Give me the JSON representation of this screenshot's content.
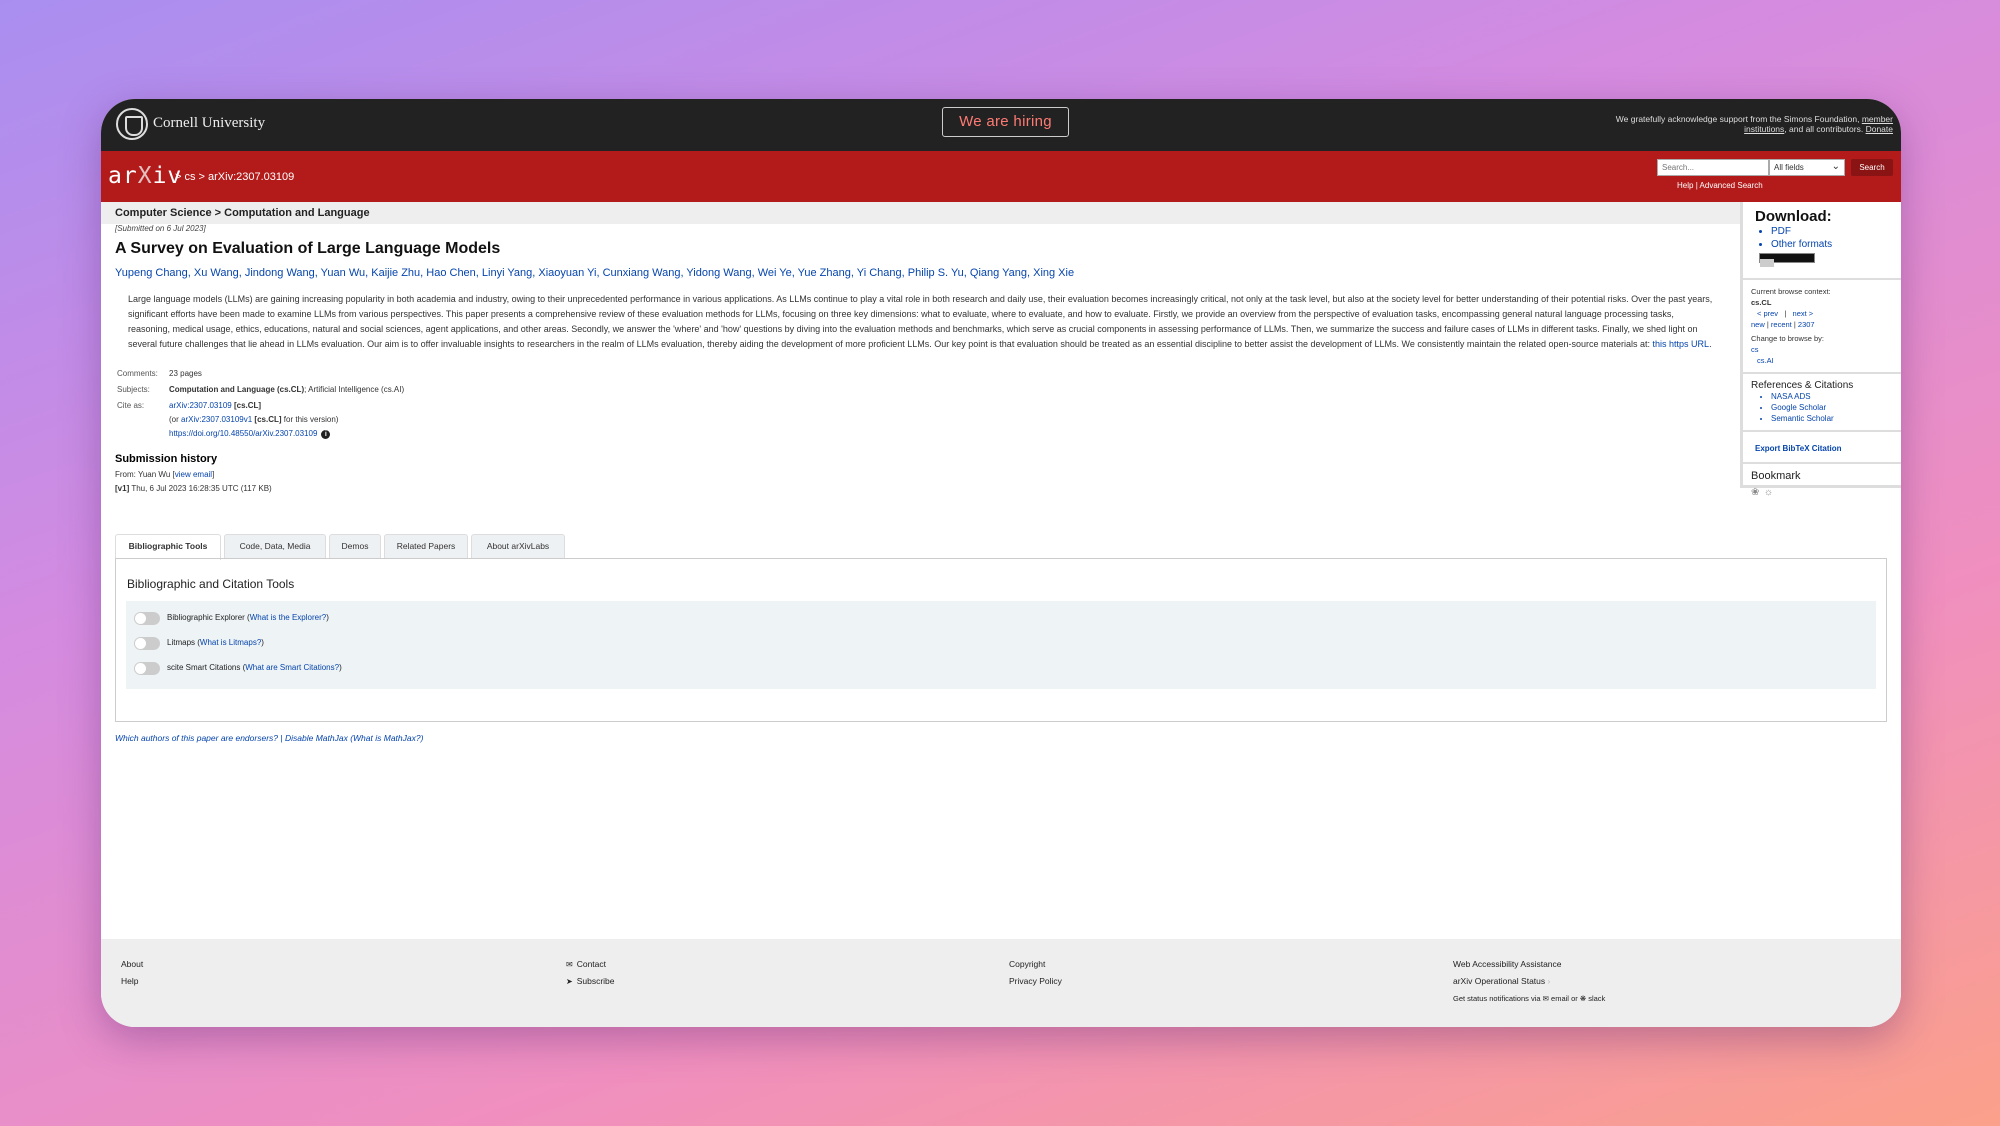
{
  "cornell": {
    "name": "Cornell University",
    "hiring": "We are hiring",
    "ack_text": "We gratefully acknowledge support from the Simons Foundation,",
    "ack_link1": "member institutions",
    "ack_mid": ", and all contributors.",
    "ack_link2": "Donate"
  },
  "header": {
    "logo_a": "ar",
    "logo_x": "X",
    "logo_b": "iv",
    "breadcrumb": "> cs > arXiv:2307.03109",
    "search_placeholder": "Search...",
    "search_field": "All fields",
    "search_button": "Search",
    "help": "Help",
    "separator": "|",
    "advanced": "Advanced Search"
  },
  "subject_header": "Computer Science > Computation and Language",
  "paper": {
    "submitted": "[Submitted on 6 Jul 2023]",
    "title": "A Survey on Evaluation of Large Language Models",
    "authors": "Yupeng Chang, Xu Wang, Jindong Wang, Yuan Wu, Kaijie Zhu, Hao Chen, Linyi Yang, Xiaoyuan Yi, Cunxiang Wang, Yidong Wang, Wei Ye, Yue Zhang, Yi Chang, Philip S. Yu, Qiang Yang, Xing Xie",
    "abstract": "Large language models (LLMs) are gaining increasing popularity in both academia and industry, owing to their unprecedented performance in various applications. As LLMs continue to play a vital role in both research and daily use, their evaluation becomes increasingly critical, not only at the task level, but also at the society level for better understanding of their potential risks. Over the past years, significant efforts have been made to examine LLMs from various perspectives. This paper presents a comprehensive review of these evaluation methods for LLMs, focusing on three key dimensions: what to evaluate, where to evaluate, and how to evaluate. Firstly, we provide an overview from the perspective of evaluation tasks, encompassing general natural language processing tasks, reasoning, medical usage, ethics, educations, natural and social sciences, agent applications, and other areas. Secondly, we answer the 'where' and 'how' questions by diving into the evaluation methods and benchmarks, which serve as crucial components in assessing performance of LLMs. Then, we summarize the success and failure cases of LLMs in different tasks. Finally, we shed light on several future challenges that lie ahead in LLMs evaluation. Our aim is to offer invaluable insights to researchers in the realm of LLMs evaluation, thereby aiding the development of more proficient LLMs. Our key point is that evaluation should be treated as an essential discipline to better assist the development of LLMs. We consistently maintain the related open-source materials at:",
    "abstract_link": "this https URL",
    "abstract_end": ".",
    "comments_label": "Comments:",
    "comments": "23 pages",
    "subjects_label": "Subjects:",
    "subjects_main": "Computation and Language (cs.CL)",
    "subjects_rest": "; Artificial Intelligence (cs.AI)",
    "cite_label": "Cite as:",
    "cite_id": "arXiv:2307.03109",
    "cite_tag": "[cs.CL]",
    "cite_or": "(or",
    "cite_v1": "arXiv:2307.03109v1",
    "cite_v1_tag": "[cs.CL]",
    "cite_version": "for this version)",
    "doi": "https://doi.org/10.48550/arXiv.2307.03109",
    "info_icon": "i",
    "history_title": "Submission history",
    "history_from": "From: Yuan Wu [",
    "history_email": "view email",
    "history_close": "]",
    "history_v1": "[v1]",
    "history_v1_text": "Thu, 6 Jul 2023 16:28:35 UTC (117 KB)"
  },
  "tabs": [
    {
      "label": "Bibliographic Tools"
    },
    {
      "label": "Code, Data, Media"
    },
    {
      "label": "Demos"
    },
    {
      "label": "Related Papers"
    },
    {
      "label": "About arXivLabs"
    }
  ],
  "tools": {
    "heading": "Bibliographic and Citation Tools",
    "items": [
      {
        "name": "Bibliographic Explorer",
        "link": "What is the Explorer?"
      },
      {
        "name": "Litmaps",
        "link": "What is Litmaps?"
      },
      {
        "name": "scite Smart Citations",
        "link": "What are Smart Citations?"
      }
    ]
  },
  "footnote": {
    "endorsers": "Which authors of this paper are endorsers?",
    "sep": "|",
    "mathjax": "Disable MathJax",
    "what_mathjax": "(What is MathJax?)"
  },
  "sidebar": {
    "download": "Download:",
    "pdf": "PDF",
    "other": "Other formats",
    "browse_context_label": "Current browse context:",
    "browse_context": "cs.CL",
    "prev": "< prev",
    "bar": "|",
    "next": "next >",
    "new": "new",
    "recent": "recent",
    "month": "2307",
    "change_browse": "Change to browse by:",
    "browse_cs": "cs",
    "browse_ai": "cs.AI",
    "refs_title": "References & Citations",
    "refs": [
      "NASA ADS",
      "Google Scholar",
      "Semantic Scholar"
    ],
    "bibtex": "Export BibTeX Citation",
    "bookmark": "Bookmark"
  },
  "footer": {
    "about": "About",
    "help": "Help",
    "contact": "Contact",
    "subscribe": "Subscribe",
    "copyright": "Copyright",
    "privacy": "Privacy Policy",
    "accessibility": "Web Accessibility Assistance",
    "status": "arXiv Operational Status",
    "notif_prefix": "Get status notifications via",
    "email": "email",
    "or": "or",
    "slack": "slack"
  },
  "colors": {
    "arxiv_red": "#b31b1b",
    "cornell_bar": "#222222",
    "link_blue": "#0645ad",
    "hiring": "#ff7a73"
  }
}
